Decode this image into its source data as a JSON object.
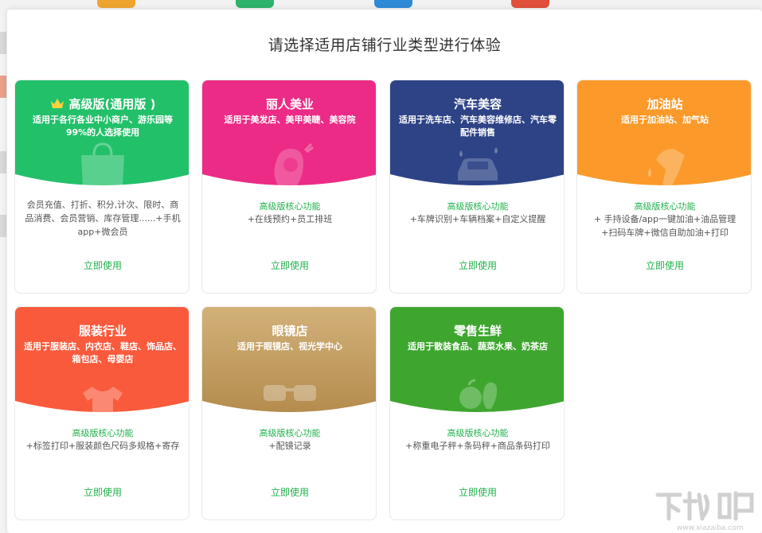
{
  "header": {
    "title": "请选择适用店铺行业类型进行体验"
  },
  "cards": [
    {
      "title": "高级版(通用版 )",
      "subtitle": "适用于各行各业中小商户、游乐园等99%的人选择使用",
      "feature_heading": "",
      "features": "会员充值、打折、积分,计次、限时、商品消费、会员营销、库存管理......+手机app+微会员",
      "action": "立即使用",
      "color": "#23c06a",
      "icon": "shopping-bag-icon"
    },
    {
      "title": "丽人美业",
      "subtitle": "适用于美发店、美甲美睫、美容院",
      "feature_heading": "高级版核心功能",
      "features": "+在线预约+员工排班",
      "action": "立即使用",
      "color": "#ec2b86",
      "icon": "woman-hair-icon"
    },
    {
      "title": "汽车美容",
      "subtitle": "适用于洗车店、汽车美容维修店、汽车零配件销售",
      "feature_heading": "高级版核心功能",
      "features": "+车牌识别+车辆档案+自定义提醒",
      "action": "立即使用",
      "color": "#2e4386",
      "icon": "car-wash-icon"
    },
    {
      "title": "加油站",
      "subtitle": "适用于加油站、加气站",
      "feature_heading": "高级版核心功能",
      "features": "+ 手持设备/app一键加油+油品管理+扫码车牌+微信自助加油+打印",
      "action": "立即使用",
      "color": "#fb9a2a",
      "icon": "fuel-nozzle-icon"
    },
    {
      "title": "服装行业",
      "subtitle": "适用于服装店、内衣店、鞋店、饰品店、箱包店、母婴店",
      "feature_heading": "高级版核心功能",
      "features": "+标签打印+服装颜色尺码多规格+寄存",
      "action": "立即使用",
      "color": "#fa5a3c",
      "icon": "t-shirt-icon"
    },
    {
      "title": "眼镜店",
      "subtitle": "适用于眼镜店、视光学中心",
      "feature_heading": "高级版核心功能",
      "features": "+配镜记录",
      "action": "立即使用",
      "color": "#c49c5c",
      "icon": "glasses-icon"
    },
    {
      "title": "零售生鲜",
      "subtitle": "适用于散装食品、蔬菜水果、奶茶店",
      "feature_heading": "高级版核心功能",
      "features": "+称重电子秤+条码秤+商品条码打印",
      "action": "立即使用",
      "color": "#3ea62f",
      "icon": "vegetables-icon"
    }
  ],
  "watermark": {
    "text": "下载吧",
    "url_text": "www.xiazaiba.com"
  }
}
